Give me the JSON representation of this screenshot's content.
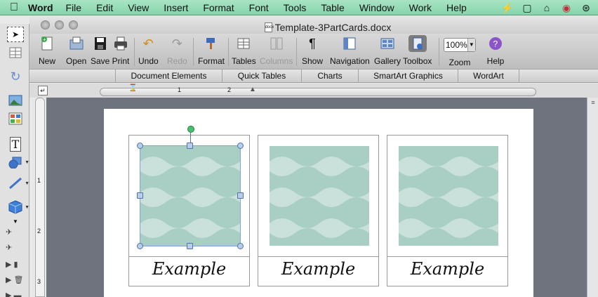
{
  "menubar": {
    "app_name": "Word",
    "items": [
      "File",
      "Edit",
      "View",
      "Insert",
      "Format",
      "Font",
      "Tools",
      "Table",
      "Window",
      "Work",
      "Help"
    ]
  },
  "window": {
    "title": "Template-3PartCards.docx",
    "doc_icon_label": "docx"
  },
  "toolbar": {
    "new": "New",
    "open": "Open",
    "save": "Save",
    "print": "Print",
    "undo": "Undo",
    "redo": "Redo",
    "format": "Format",
    "tables": "Tables",
    "columns": "Columns",
    "show": "Show",
    "navigation": "Navigation",
    "gallery": "Gallery",
    "toolbox": "Toolbox",
    "zoom": "Zoom",
    "zoom_value": "100%",
    "help": "Help"
  },
  "ribbon": {
    "tabs": [
      "Document Elements",
      "Quick Tables",
      "Charts",
      "SmartArt Graphics",
      "WordArt"
    ]
  },
  "ruler": {
    "mark_1": "1",
    "mark_2": "2"
  },
  "vruler": {
    "mark_1": "1",
    "mark_2": "2",
    "mark_3": "3"
  },
  "cards": [
    {
      "caption": "Example",
      "selected": true
    },
    {
      "caption": "Example",
      "selected": false
    },
    {
      "caption": "Example",
      "selected": false
    }
  ],
  "colors": {
    "menubar_accent": "#8fd8b0",
    "card_pattern_base": "#a9cfc4",
    "card_pattern_wave": "#c9e1da",
    "selection_handle": "#4f74a8",
    "rotation_handle": "#47c06f"
  }
}
